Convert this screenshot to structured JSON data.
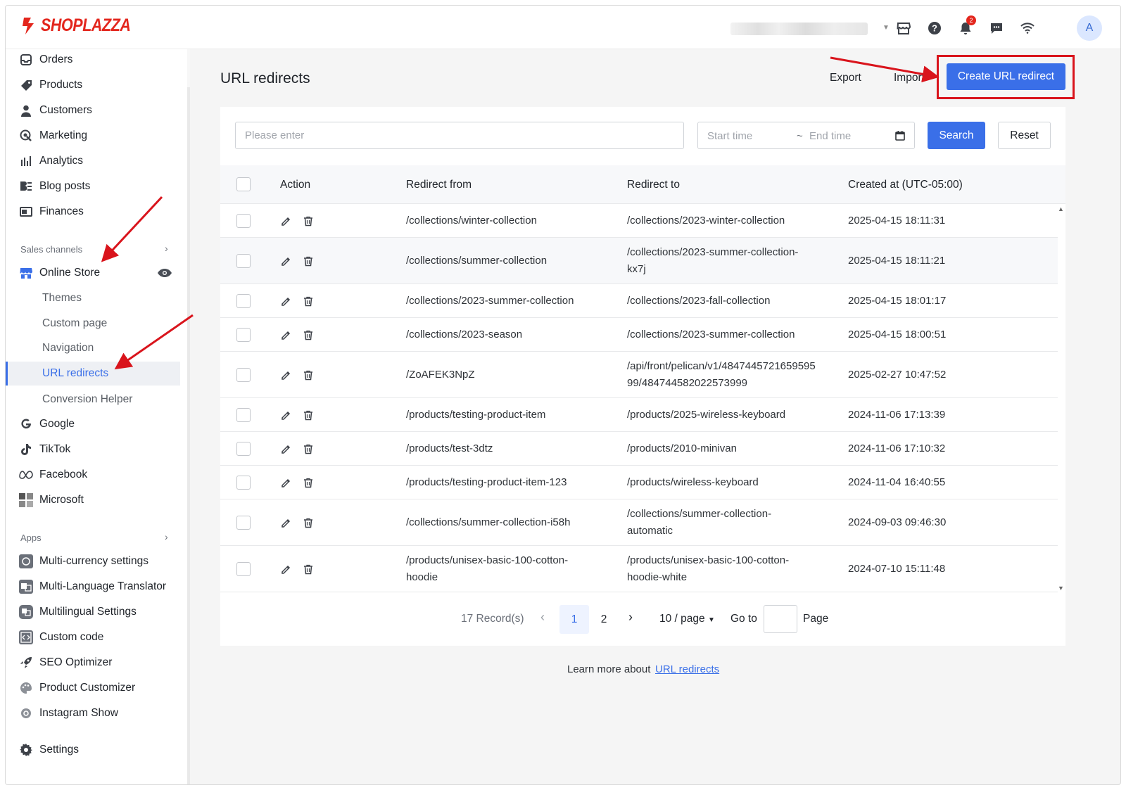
{
  "header": {
    "logo_text": "SHOPLAZZA",
    "notification_count": "2",
    "avatar_initial": "A"
  },
  "sidebar": {
    "items": [
      {
        "label": "Orders",
        "icon": "inbox-icon"
      },
      {
        "label": "Products",
        "icon": "tag-icon"
      },
      {
        "label": "Customers",
        "icon": "person-icon"
      },
      {
        "label": "Marketing",
        "icon": "marketing-icon"
      },
      {
        "label": "Analytics",
        "icon": "bar-chart-icon"
      },
      {
        "label": "Blog posts",
        "icon": "blog-icon"
      },
      {
        "label": "Finances",
        "icon": "finance-icon"
      }
    ],
    "sales_channels_label": "Sales channels",
    "online_store": "Online Store",
    "online_store_sub": [
      "Themes",
      "Custom page",
      "Navigation",
      "URL redirects",
      "Conversion Helper"
    ],
    "channels": [
      {
        "label": "Google",
        "icon": "google-icon"
      },
      {
        "label": "TikTok",
        "icon": "tiktok-icon"
      },
      {
        "label": "Facebook",
        "icon": "meta-icon"
      },
      {
        "label": "Microsoft",
        "icon": "microsoft-icon"
      }
    ],
    "apps_label": "Apps",
    "apps": [
      {
        "label": "Multi-currency settings",
        "icon": "currency-icon"
      },
      {
        "label": "Multi-Language Translator",
        "icon": "translate-icon"
      },
      {
        "label": "Multilingual Settings",
        "icon": "multilingual-icon"
      },
      {
        "label": "Custom code",
        "icon": "code-icon"
      },
      {
        "label": "SEO Optimizer",
        "icon": "rocket-icon"
      },
      {
        "label": "Product Customizer",
        "icon": "palette-icon"
      },
      {
        "label": "Instagram Show",
        "icon": "instagram-icon"
      }
    ],
    "settings": "Settings"
  },
  "page": {
    "title": "URL redirects",
    "export": "Export",
    "import": "Import",
    "create": "Create URL redirect"
  },
  "filters": {
    "search_placeholder": "Please enter",
    "start_time": "Start time",
    "tilde": "~",
    "end_time": "End time",
    "search": "Search",
    "reset": "Reset"
  },
  "table": {
    "columns": [
      "Action",
      "Redirect from",
      "Redirect to",
      "Created at (UTC-05:00)"
    ],
    "rows": [
      {
        "from": [
          "/collections/winter-collection"
        ],
        "to": [
          "/collections/2023-winter-collection"
        ],
        "created": "2025-04-15 18:11:31"
      },
      {
        "from": [
          "/collections/summer-collection"
        ],
        "to": [
          "/collections/2023-summer-collection-",
          "kx7j"
        ],
        "created": "2025-04-15 18:11:21"
      },
      {
        "from": [
          "/collections/2023-summer-collection"
        ],
        "to": [
          "/collections/2023-fall-collection"
        ],
        "created": "2025-04-15 18:01:17"
      },
      {
        "from": [
          "/collections/2023-season"
        ],
        "to": [
          "/collections/2023-summer-collection"
        ],
        "created": "2025-04-15 18:00:51"
      },
      {
        "from": [
          "/ZoAFEK3NpZ"
        ],
        "to": [
          "/api/front/pelican/v1/4847445721659595",
          "99/484744582022573999"
        ],
        "created": "2025-02-27 10:47:52"
      },
      {
        "from": [
          "/products/testing-product-item"
        ],
        "to": [
          "/products/2025-wireless-keyboard"
        ],
        "created": "2024-11-06 17:13:39"
      },
      {
        "from": [
          "/products/test-3dtz"
        ],
        "to": [
          "/products/2010-minivan"
        ],
        "created": "2024-11-06 17:10:32"
      },
      {
        "from": [
          "/products/testing-product-item-123"
        ],
        "to": [
          "/products/wireless-keyboard"
        ],
        "created": "2024-11-04 16:40:55"
      },
      {
        "from": [
          "/collections/summer-collection-i58h"
        ],
        "to": [
          "/collections/summer-collection-",
          "automatic"
        ],
        "created": "2024-09-03 09:46:30"
      },
      {
        "from": [
          "/products/unisex-basic-100-cotton-",
          "hoodie"
        ],
        "to": [
          "/products/unisex-basic-100-cotton-",
          "hoodie-white"
        ],
        "created": "2024-07-10 15:11:48"
      }
    ]
  },
  "pagination": {
    "records": "17 Record(s)",
    "pages": [
      "1",
      "2"
    ],
    "current": "1",
    "page_size": "10 / page",
    "goto": "Go to",
    "page_label": "Page"
  },
  "footer": {
    "learn_more": "Learn more about",
    "link": "URL redirects"
  },
  "colors": {
    "accent": "#3a6fe8",
    "brand": "#e3261d",
    "annotation": "#d9141c"
  }
}
